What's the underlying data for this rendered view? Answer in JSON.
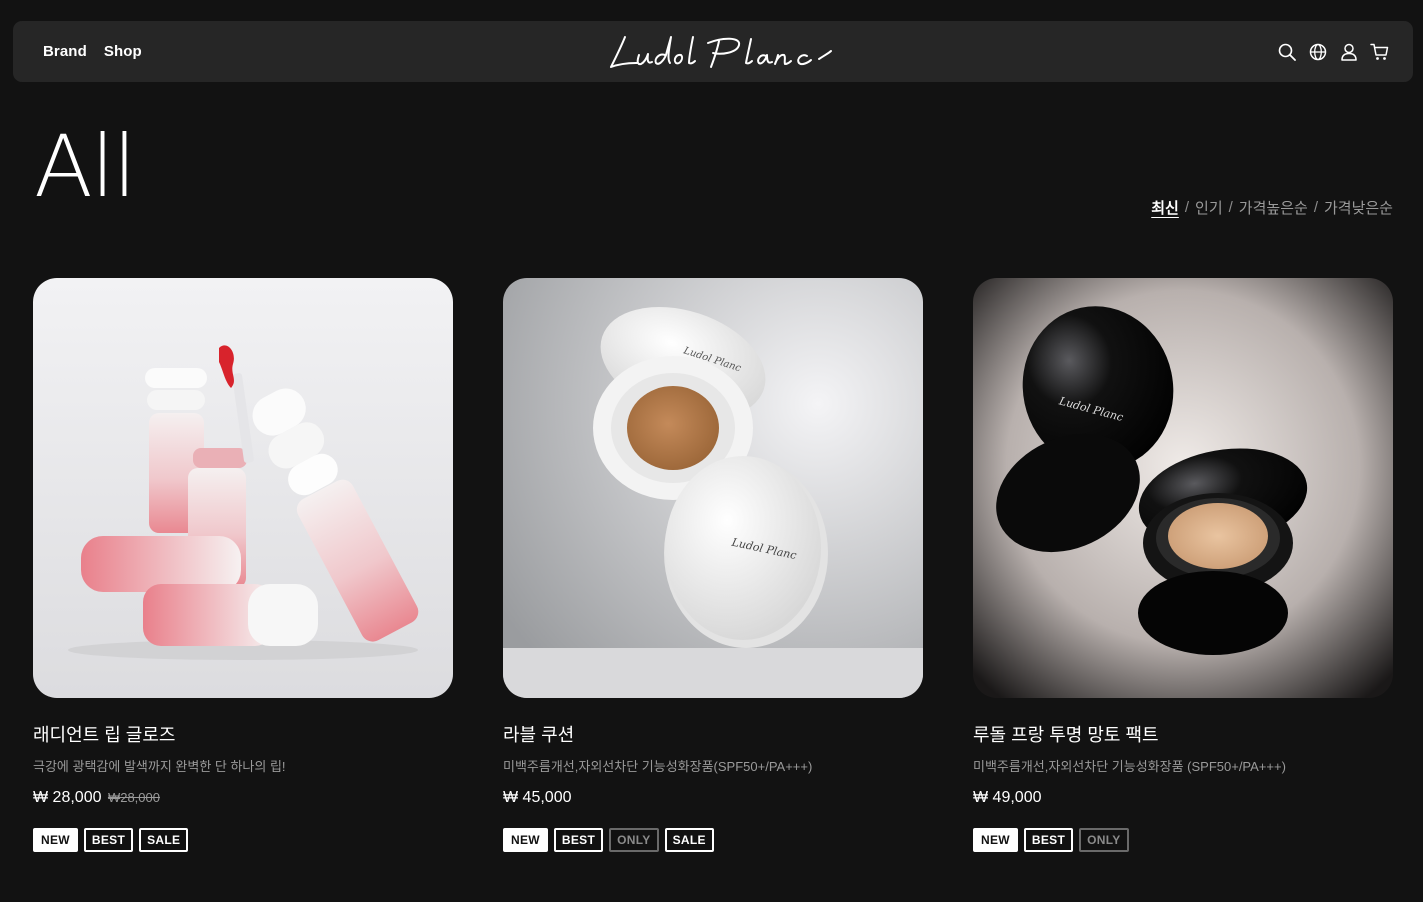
{
  "header": {
    "nav": [
      "Brand",
      "Shop"
    ],
    "logo_text": "Ludol Planc",
    "icons": [
      "search-icon",
      "globe-icon",
      "user-icon",
      "cart-icon"
    ]
  },
  "page_title": "All",
  "sort": {
    "options": [
      "최신",
      "인기",
      "가격높은순",
      "가격낮은순"
    ],
    "active": "최신"
  },
  "products": [
    {
      "name": "래디언트 립 글로즈",
      "desc": "극강에 광택감에 발색까지 완벽한 단 하나의 립!",
      "price": "₩ 28,000",
      "original_price": "₩28,000",
      "badges": [
        "NEW",
        "BEST",
        "SALE"
      ]
    },
    {
      "name": "라블 쿠션",
      "desc": "미백주름개선,자외선차단 기능성화장품(SPF50+/PA+++)",
      "price": "₩ 45,000",
      "original_price": "",
      "badges": [
        "NEW",
        "BEST",
        "ONLY",
        "SALE"
      ]
    },
    {
      "name": "루돌 프랑 투명 망토 팩트",
      "desc": "미백주름개선,자외선차단 기능성화장품 (SPF50+/PA+++)",
      "price": "₩ 49,000",
      "original_price": "",
      "badges": [
        "NEW",
        "BEST",
        "ONLY"
      ]
    }
  ],
  "colors": {
    "background": "#121212",
    "header": "#262626",
    "muted": "#9a9a9a"
  }
}
